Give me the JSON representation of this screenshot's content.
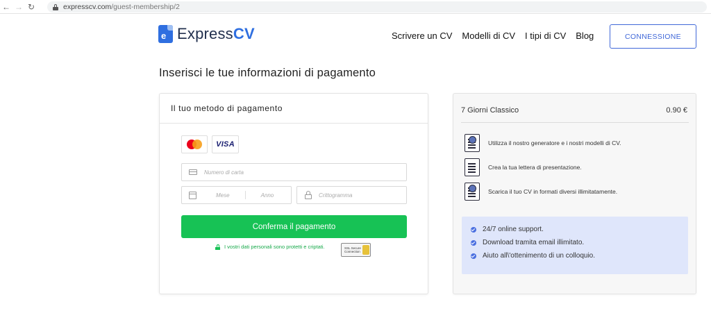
{
  "browser": {
    "url_host": "expresscv.com",
    "url_path": "/guest-membership/2",
    "back_icon": "←",
    "forward_icon": "→",
    "reload_icon": "↻"
  },
  "header": {
    "logo_mark": "e",
    "logo_word": "Express",
    "logo_cv": "CV",
    "nav": [
      "Scrivere un CV",
      "Modelli di CV",
      "I tipi di CV",
      "Blog"
    ],
    "login_label": "CONNESSIONE"
  },
  "page": {
    "title": "Inserisci le tue informazioni di pagamento"
  },
  "payment": {
    "heading": "Il tuo metodo di pagamento",
    "visa_label": "VISA",
    "card_number_placeholder": "Numero di carta",
    "month_placeholder": "Mese",
    "year_placeholder": "Anno",
    "cvv_placeholder": "Crittogramma",
    "confirm_label": "Conferma il pagamento",
    "secure_text": "I vostri dati personali sono protetti e criptati.",
    "ssl_text": "SSL Secure Connection"
  },
  "summary": {
    "plan": "7 Giorni Classico",
    "price": "0.90 €",
    "features": [
      "Utilizza il nostro generatore e i nostri modelli di CV.",
      "Crea la tua lettera di presentazione.",
      "Scarica il tuo CV in formati diversi illimitatamente."
    ],
    "support": [
      "24/7 online support.",
      "Download tramita email illimitato.",
      "Aiuto all\\'ottenimento di un colloquio."
    ]
  }
}
